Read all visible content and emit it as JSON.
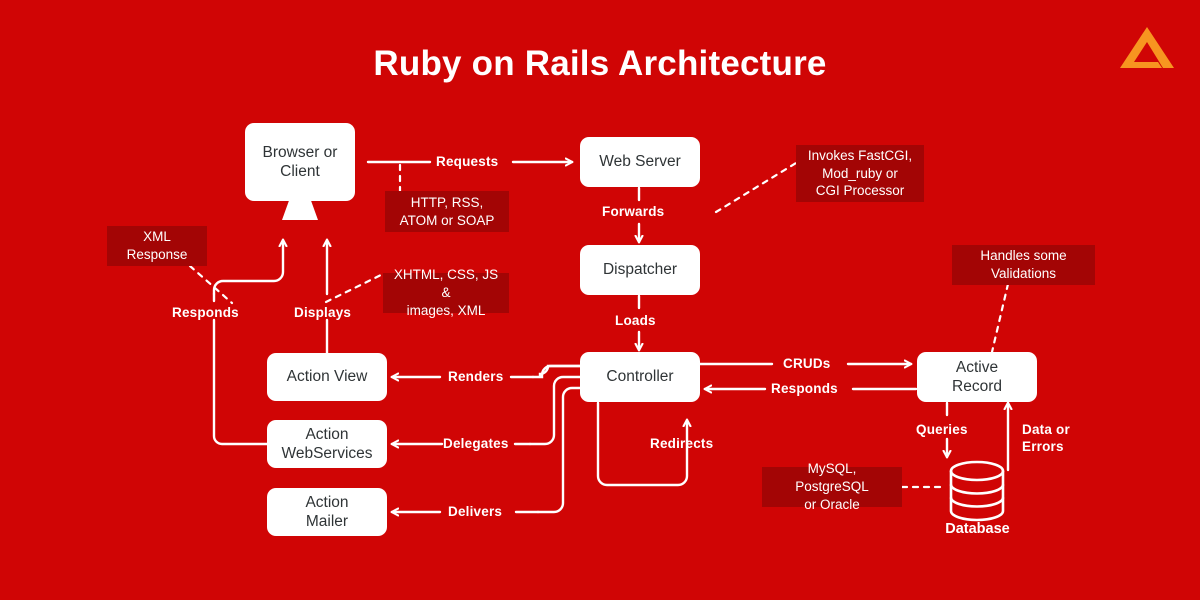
{
  "page": {
    "title": "Ruby on Rails Architecture",
    "background_color": "#D00505",
    "annotation_color": "#A30505",
    "node_color": "#FFFFFF",
    "text_color": "#2F3436",
    "logo_color": "#F79520",
    "logo_name": "triangle-logo"
  },
  "nodes": {
    "browser": "Browser or\nClient",
    "browser_line1": "Browser or",
    "browser_line2": "Client",
    "web_server": "Web Server",
    "dispatcher": "Dispatcher",
    "controller": "Controller",
    "active_record_line1": "Active",
    "active_record_line2": "Record",
    "action_view": "Action View",
    "action_webservices_line1": "Action",
    "action_webservices_line2": "WebServices",
    "action_mailer_line1": "Action",
    "action_mailer_line2": "Mailer",
    "database_caption": "Database"
  },
  "annotations": {
    "http_rss": "HTTP, RSS,\nATOM or SOAP",
    "http_rss_line1": "HTTP, RSS,",
    "http_rss_line2": "ATOM or SOAP",
    "invokes_line1": "Invokes FastCGI,",
    "invokes_line2": "Mod_ruby or",
    "invokes_line3": "CGI Processor",
    "xml_response_line1": "XML",
    "xml_response_line2": "Response",
    "xhtml_line1": "XHTML, CSS, JS &",
    "xhtml_line2": "images,  XML",
    "handles_line1": "Handles some",
    "handles_line2": "Validations",
    "mysql_line1": "MySQL, PostgreSQL",
    "mysql_line2": "or Oracle"
  },
  "edges": {
    "requests": "Requests",
    "forwards": "Forwards",
    "loads": "Loads",
    "renders": "Renders",
    "delegates": "Delegates",
    "delivers": "Delivers",
    "redirects": "Redirects",
    "cruds": "CRUDs",
    "responds_controller": "Responds",
    "responds_browser": "Responds",
    "displays": "Displays",
    "queries": "Queries",
    "data_or_errors_line1": "Data or",
    "data_or_errors_line2": "Errors"
  }
}
